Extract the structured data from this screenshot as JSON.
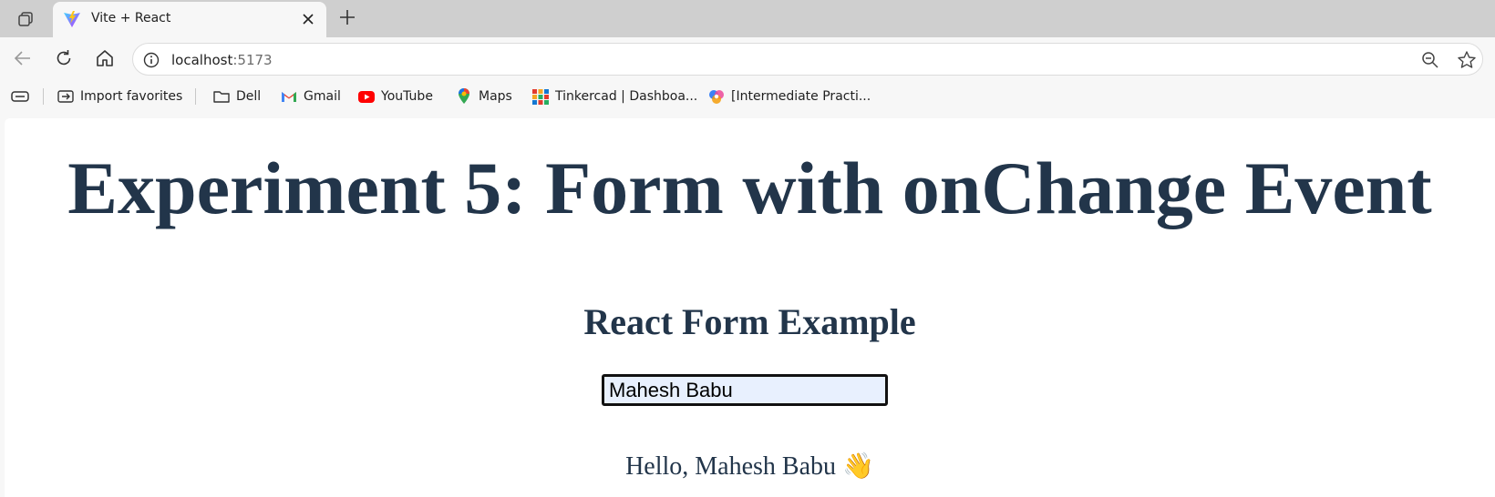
{
  "browser": {
    "tab": {
      "title": "Vite + React"
    },
    "address": {
      "host": "localhost",
      "port": ":5173"
    },
    "favorites": [
      {
        "label": "Import favorites",
        "icon": "import-favorites-icon"
      },
      {
        "label": "Dell",
        "icon": "folder-icon"
      },
      {
        "label": "Gmail",
        "icon": "gmail-icon"
      },
      {
        "label": "YouTube",
        "icon": "youtube-icon"
      },
      {
        "label": "Maps",
        "icon": "maps-icon"
      },
      {
        "label": "Tinkercad | Dashboa...",
        "icon": "tinkercad-icon"
      },
      {
        "label": "[Intermediate Practi...",
        "icon": "copilot-icon"
      }
    ],
    "colors": {
      "tabstrip": "#cfcfcf",
      "toolbar": "#f7f7f7"
    }
  },
  "page": {
    "heading": "Experiment 5: Form with onChange Event",
    "subheading": "React Form Example",
    "input_value": "Mahesh Babu",
    "greeting": "Hello, Mahesh Babu 👋",
    "colors": {
      "heading": "#22354a",
      "input_bg": "#e8f0fe"
    }
  }
}
